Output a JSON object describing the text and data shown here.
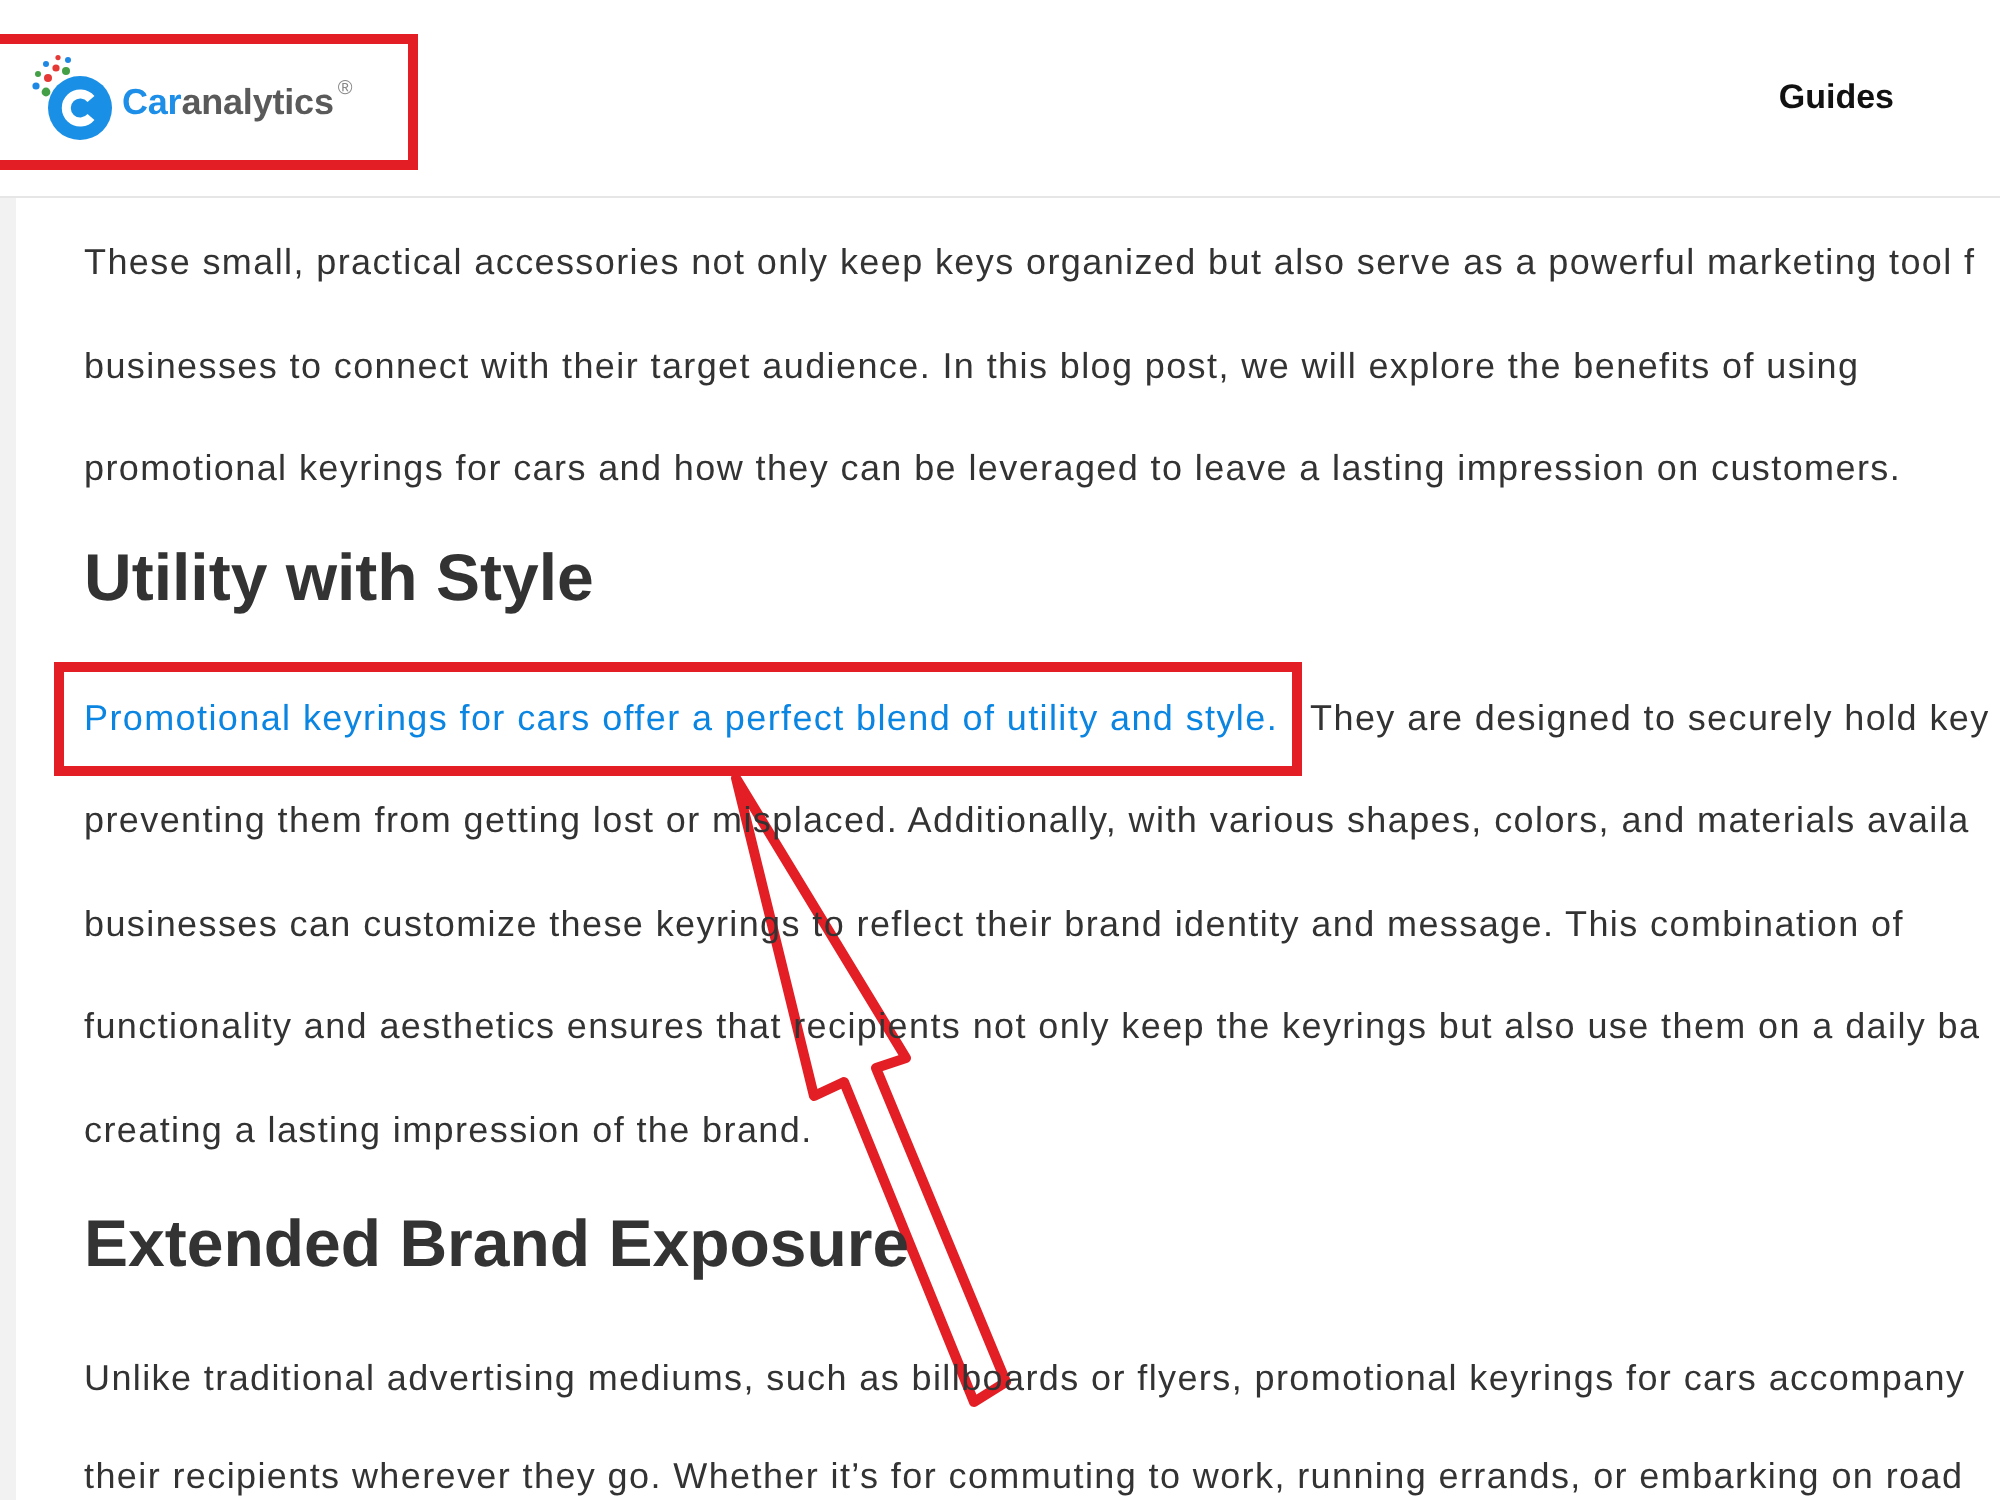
{
  "header": {
    "logo": {
      "wordmark": [
        "Car",
        "analytics"
      ],
      "trademark": "®",
      "highlighted": true
    },
    "nav": [
      {
        "label": "Guides"
      }
    ]
  },
  "article": {
    "blocks": [
      {
        "kind": "paragraph",
        "lines": [
          {
            "segments": [
              {
                "kind": "text",
                "text": "These small, practical accessories not only keep keys organized but also serve as a powerful marketing tool f"
              }
            ]
          },
          {
            "segments": [
              {
                "kind": "text",
                "text": "businesses to connect with their target audience. In this blog post, we will explore the benefits of using"
              }
            ]
          },
          {
            "segments": [
              {
                "kind": "text",
                "text": "promotional keyrings for cars and how they can be leveraged to leave a lasting impression on customers."
              }
            ]
          }
        ]
      },
      {
        "kind": "heading",
        "text": "Utility with Style"
      },
      {
        "kind": "paragraph",
        "lines": [
          {
            "segments": [
              {
                "kind": "link",
                "text": "Promotional keyrings for cars offer a perfect blend of utility and style.",
                "highlighted": true,
                "pointer_arrow": true
              },
              {
                "kind": "text",
                "text": "They are designed to securely hold key"
              }
            ]
          },
          {
            "segments": [
              {
                "kind": "text",
                "text": "preventing them from getting lost or misplaced. Additionally, with various shapes, colors, and materials availa"
              }
            ]
          },
          {
            "segments": [
              {
                "kind": "text",
                "text": "businesses can customize these keyrings to reflect their brand identity and message. This combination of"
              }
            ]
          },
          {
            "segments": [
              {
                "kind": "text",
                "text": "functionality and aesthetics ensures that recipients not only keep the keyrings but also use them on a daily ba"
              }
            ]
          },
          {
            "segments": [
              {
                "kind": "text",
                "text": "creating a lasting impression of the brand."
              }
            ]
          }
        ]
      },
      {
        "kind": "heading",
        "text": "Extended Brand Exposure"
      },
      {
        "kind": "paragraph",
        "lines": [
          {
            "segments": [
              {
                "kind": "text",
                "text": "Unlike traditional advertising mediums, such as billboards or flyers, promotional keyrings for cars accompany"
              }
            ]
          },
          {
            "segments": [
              {
                "kind": "text",
                "text": "their recipients wherever they go. Whether it’s for commuting to work, running errands, or embarking on road"
              }
            ]
          }
        ]
      }
    ]
  }
}
